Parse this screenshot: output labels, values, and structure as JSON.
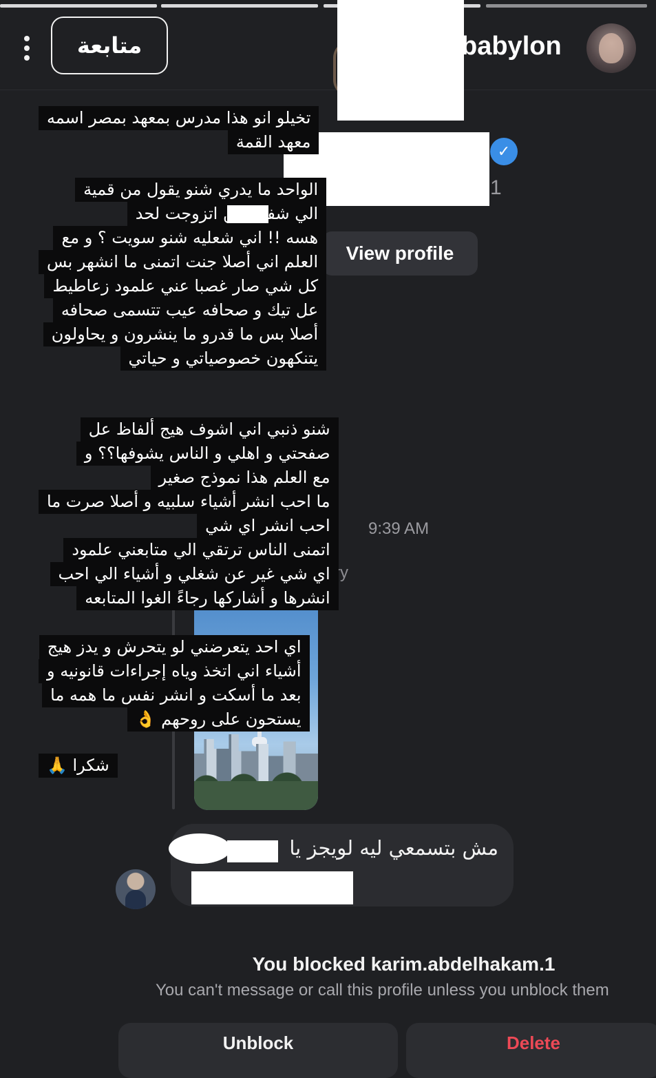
{
  "header": {
    "follow_label": "متابعة",
    "username": "babylon"
  },
  "profile_preview": {
    "verified_icon": "check-badge-icon",
    "handle_suffix": "1",
    "view_profile_label": "View profile"
  },
  "conversation": {
    "timestamp": "9:39 AM",
    "story_label": "story",
    "messages": [
      {
        "lines": [
          "تخيلو انو هذا مدرس بمعهد بمصر اسمه",
          "معهد القمة"
        ]
      },
      {
        "lines": [
          "الواحد ما يدري شنو يقول من قمية",
          "الي شفتها من اتزوجت لحد",
          "هسه !! اني شعليه شنو سويت ؟ و مع",
          "العلم اني أصلا جنت اتمنى ما انشهر بس",
          "كل شي صار غصبا عني علمود زعاطيط",
          "عل تيك و صحافه عيب تتسمى صحافه",
          "أصلا بس ما قدرو ما ينشرون و يحاولون",
          "يتنكهون خصوصياتي و حياتي"
        ]
      },
      {
        "lines": [
          "شنو ذنبي اني اشوف هيج ألفاظ عل",
          "صفحتي و اهلي و الناس يشوفها؟؟ و",
          "مع العلم هذا نموذج صغير",
          "ما احب انشر أشياء سلبيه و أصلا صرت ما",
          "احب انشر اي شي",
          "اتمنى الناس ترتقي الي متابعني علمود",
          "اي شي غير عن شغلي و أشياء الي احب",
          "انشرها و أشاركها رجاءً الغوا المتابعه"
        ]
      },
      {
        "lines": [
          "اي احد يتعرضني لو يتحرش و يدز هيج",
          "أشياء اني اتخذ وياه إجراءات قانونيه و",
          "بعد ما أسكت و انشر نفس ما همه ما",
          "يستحون على روحهم 👌"
        ]
      },
      {
        "lines": [
          "شكرا 🙏"
        ]
      }
    ],
    "reply": {
      "text": "مش بتسمعي ليه لويجز يا"
    }
  },
  "blocked": {
    "title": "You blocked karim.abdelhakam.1",
    "subtitle": "You can't message or call this profile unless you unblock them"
  },
  "actions": {
    "unblock_label": "Unblock",
    "delete_label": "Delete"
  },
  "colors": {
    "background": "#1f2023",
    "verified_blue": "#3a8ee6",
    "delete_red": "#ed4956",
    "text_bubble_bg": "#0b0b0c"
  }
}
